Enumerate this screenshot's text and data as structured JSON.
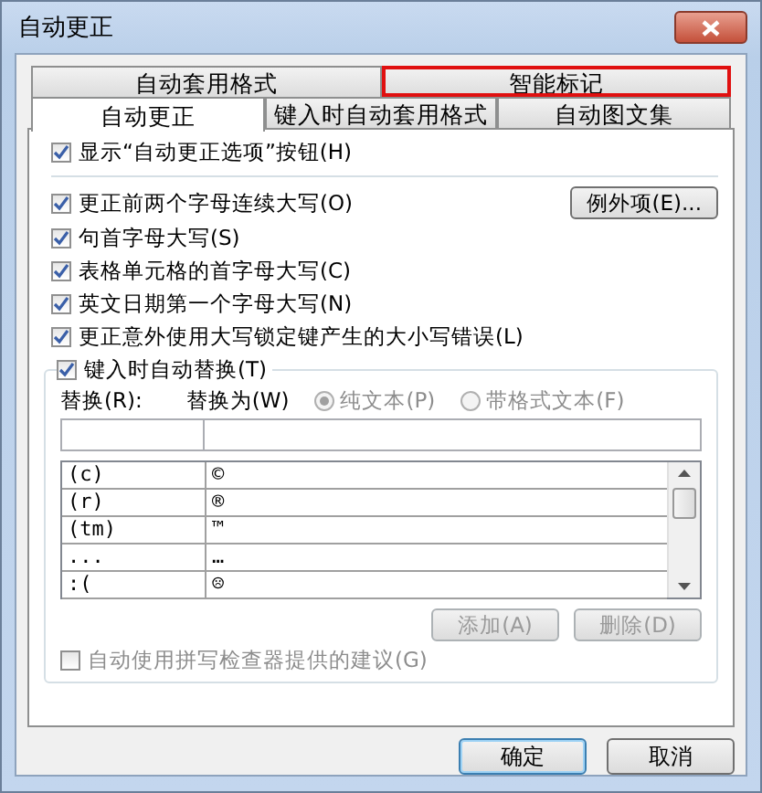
{
  "window": {
    "title": "自动更正"
  },
  "tab_rows": [
    [
      {
        "label": "自动套用格式",
        "selected": false,
        "highlighted": false
      },
      {
        "label": "智能标记",
        "selected": false,
        "highlighted": true
      }
    ],
    [
      {
        "label": "自动更正",
        "selected": true,
        "highlighted": false
      },
      {
        "label": "键入时自动套用格式",
        "selected": false,
        "highlighted": false
      },
      {
        "label": "自动图文集",
        "selected": false,
        "highlighted": false
      }
    ]
  ],
  "show_options": {
    "label": "显示“自动更正选项”按钮(H)",
    "checked": true
  },
  "options": [
    {
      "label": "更正前两个字母连续大写(O)",
      "checked": true
    },
    {
      "label": "句首字母大写(S)",
      "checked": true
    },
    {
      "label": "表格单元格的首字母大写(C)",
      "checked": true
    },
    {
      "label": "英文日期第一个字母大写(N)",
      "checked": true
    },
    {
      "label": "更正意外使用大写锁定键产生的大小写错误(L)",
      "checked": true
    }
  ],
  "exceptions_button": "例外项(E)...",
  "replace_group": {
    "label": "键入时自动替换(T)",
    "checked": true,
    "replace_label": "替换(R):",
    "with_label": "替换为(W)",
    "formats": [
      {
        "label": "纯文本(P)",
        "selected": true,
        "disabled": true
      },
      {
        "label": "带格式文本(F)",
        "selected": false,
        "disabled": true
      }
    ],
    "rows": [
      {
        "replace": "(c)",
        "with": "©"
      },
      {
        "replace": "(r)",
        "with": "®"
      },
      {
        "replace": "(tm)",
        "with": "™"
      },
      {
        "replace": "...",
        "with": "…"
      },
      {
        "replace": ":(",
        "with": "☹"
      }
    ],
    "buttons": [
      {
        "label": "添加(A)",
        "disabled": true
      },
      {
        "label": "删除(D)",
        "disabled": true
      }
    ],
    "spell": {
      "label": "自动使用拼写检查器提供的建议(G)",
      "checked": false,
      "disabled": true
    }
  },
  "buttons": [
    {
      "label": "确定",
      "default": true
    },
    {
      "label": "取消",
      "default": false
    }
  ]
}
